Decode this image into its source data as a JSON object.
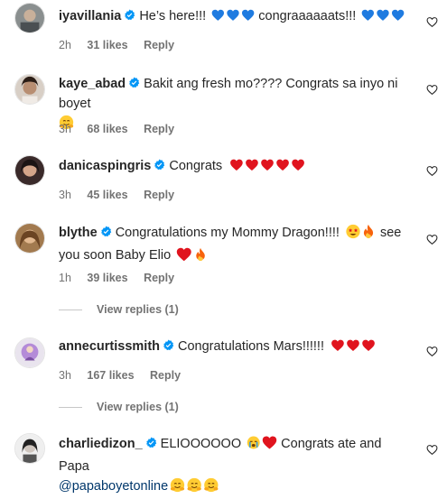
{
  "comments": [
    {
      "username": "iyavillania",
      "text": "He’s here!!! ",
      "text2": " congraaaaaats!!! ",
      "time": "2h",
      "likes": "31 likes",
      "reply": "Reply",
      "emojis1": "blue-hearts",
      "emojis2": "blue-hearts"
    },
    {
      "username": "kaye_abad",
      "text": "Bakit ang fresh mo???? Congrats sa inyo ni boyet",
      "time": "3h",
      "likes": "68 likes",
      "reply": "Reply",
      "emojis1": "hugging-face"
    },
    {
      "username": "danicaspingris",
      "text": "Congrats ",
      "time": "3h",
      "likes": "45 likes",
      "reply": "Reply",
      "emojis1": "red-hearts"
    },
    {
      "username": "blythe",
      "text": "Congratulations my Mommy Dragon!!!! ",
      "text2": " see you soon Baby Elio ",
      "time": "1h",
      "likes": "39 likes",
      "reply": "Reply",
      "emojis1": "star-struck-fire",
      "emojis2": "heart-fire"
    },
    {
      "username": "annecurtissmith",
      "text": "Congratulations Mars!!!!!! ",
      "time": "3h",
      "likes": "167 likes",
      "reply": "Reply",
      "emojis1": "red-hearts"
    },
    {
      "username": "charliedizon_",
      "text": "ELIOOOOOO ",
      "text2": " Congrats ate and Papa",
      "mention": "@papaboyetonline",
      "time": "",
      "likes": "",
      "reply": "",
      "emojis1": "crying-heart",
      "emojis2": "hugging-faces"
    }
  ],
  "view_replies": [
    "View replies (1)",
    "View replies (1)"
  ],
  "colors": {
    "blue_heart": "#1f7be0",
    "red_heart": "#e0141e",
    "verified": "#0095f6",
    "mention": "#00376b"
  }
}
